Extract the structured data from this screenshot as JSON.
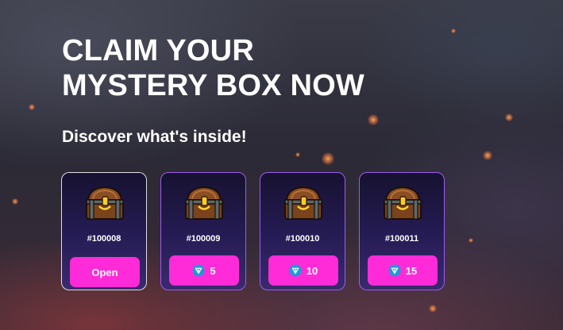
{
  "hero": {
    "title_line1": "CLAIM YOUR",
    "title_line2": "MYSTERY BOX NOW",
    "subtitle": "Discover what's inside!"
  },
  "boxes": [
    {
      "id": "#100008",
      "action": "Open",
      "icon": "treasure-chest-icon"
    },
    {
      "id": "#100009",
      "price": "5",
      "icon": "treasure-chest-icon",
      "currency_icon": "ton-coin-icon"
    },
    {
      "id": "#100010",
      "price": "10",
      "icon": "treasure-chest-icon",
      "currency_icon": "ton-coin-icon"
    },
    {
      "id": "#100011",
      "price": "15",
      "icon": "treasure-chest-icon",
      "currency_icon": "ton-coin-icon"
    }
  ],
  "colors": {
    "button": "#ff2bd8",
    "card_top": "#161230",
    "card_bottom": "#3a2a6e",
    "card_border_active": "#9b5cf0",
    "coin": "#1a9ad6"
  }
}
